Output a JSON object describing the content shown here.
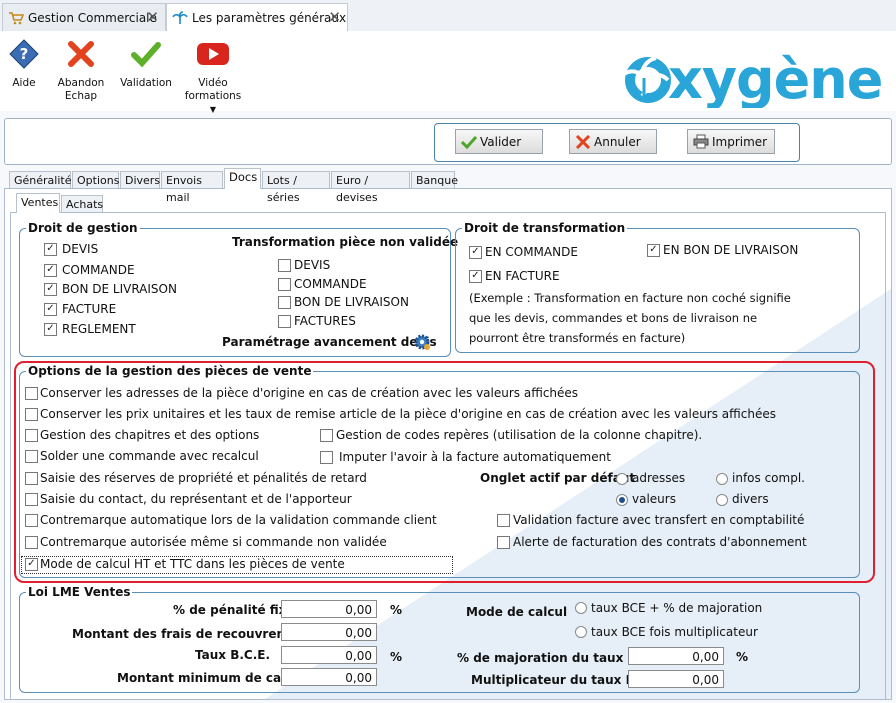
{
  "doc_tabs": [
    {
      "label": "Gestion Commerciale",
      "close": "✕"
    },
    {
      "label": "Les paramètres généraux",
      "close": "✕"
    }
  ],
  "ribbon": {
    "aide": "Aide",
    "abandon_1": "Abandon",
    "abandon_2": "Echap",
    "validation": "Validation",
    "video_1": "Vidéo",
    "video_2": "formations",
    "video_arrow": "▼"
  },
  "logo": {
    "text": "xygène",
    "color": "#2aa5d8"
  },
  "actions": {
    "valider": "Valider",
    "annuler": "Annuler",
    "imprimer": "Imprimer"
  },
  "main_tabs": [
    "Généralités",
    "Options",
    "Divers",
    "Envois mail",
    "Docs",
    "Lots / séries",
    "Euro / devises",
    "Banque"
  ],
  "sub_tabs": [
    "Ventes",
    "Achats"
  ],
  "droit_gestion": {
    "title": "Droit de gestion",
    "items": [
      {
        "label": "DEVIS",
        "checked": true
      },
      {
        "label": "COMMANDE",
        "checked": true
      },
      {
        "label": "BON DE LIVRAISON",
        "checked": true
      },
      {
        "label": "FACTURE",
        "checked": true
      },
      {
        "label": "REGLEMENT",
        "checked": true
      }
    ],
    "transfo_title": "Transformation pièce non validée",
    "transfo_items": [
      {
        "label": "DEVIS",
        "checked": false
      },
      {
        "label": "COMMANDE",
        "checked": false
      },
      {
        "label": "BON DE LIVRAISON",
        "checked": false
      },
      {
        "label": "FACTURES",
        "checked": false
      }
    ],
    "param_label": "Paramétrage avancement devis"
  },
  "droit_transfo": {
    "title": "Droit de transformation",
    "en_commande": "EN COMMANDE",
    "en_bon": "EN BON DE LIVRAISON",
    "en_facture": "EN FACTURE",
    "note_1": "(Exemple : Transformation en facture non coché signifie",
    "note_2": "que les devis, commandes et bons de livraison ne",
    "note_3": "pourront être transformés en facture)"
  },
  "options": {
    "title": "Options de la gestion des pièces de vente",
    "o1": "Conserver les adresses de la pièce d'origine en cas de création avec les valeurs affichées",
    "o2": "Conserver les prix unitaires et les taux de remise article de la pièce d'origine en cas de création avec les valeurs affichées",
    "o3": "Gestion des chapitres et des options",
    "o3b": "Gestion de codes repères (utilisation de la colonne chapitre).",
    "o4": "Solder une commande avec recalcul",
    "o4b": "Imputer l'avoir à la facture automatiquement",
    "o5": "Saisie des réserves de propriété et pénalités de retard",
    "onglet_label": "Onglet actif par défaut",
    "r_adresses": "adresses",
    "r_infos": "infos compl.",
    "r_valeurs": "valeurs",
    "r_divers": "divers",
    "o6": "Saisie du contact, du représentant et de l'apporteur",
    "o7": "Contremarque automatique lors de la validation commande client",
    "o7b": "Validation facture avec transfert en comptabilité",
    "o8": "Contremarque autorisée même si commande non validée",
    "o8b": "Alerte de facturation des contrats d'abonnement",
    "o9": "Mode de calcul HT et TTC dans les pièces de vente",
    "checkmark": "✓",
    "highlight_color": "#e0202e"
  },
  "lme": {
    "title": "Loi LME Ventes",
    "penalite_label": "% de pénalité fixe",
    "penalite_value": "0,00",
    "pct": "%",
    "frais_label": "Montant des frais de recouvrement",
    "frais_value": "0,00",
    "taux_label": "Taux B.C.E.",
    "taux_value": "0,00",
    "min_label": "Montant minimum de calcul",
    "min_value": "0,00",
    "mode_label": "Mode de calcul",
    "mode_1": "taux BCE + % de majoration",
    "mode_2": "taux BCE fois multiplicateur",
    "maj_label": "% de majoration du taux BCE",
    "maj_value": "0,00",
    "mult_label": "Multiplicateur du taux BCE",
    "mult_value": "0,00"
  }
}
